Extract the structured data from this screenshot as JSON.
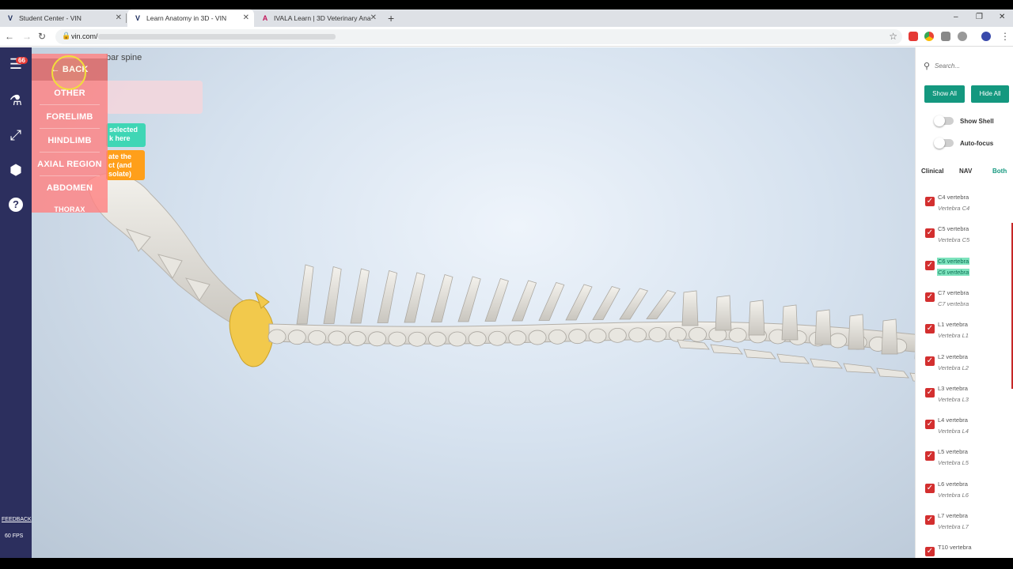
{
  "browser": {
    "tabs": [
      {
        "title": "Student Center - VIN",
        "favicon": "V",
        "active": false
      },
      {
        "title": "Learn Anatomy in 3D - VIN",
        "favicon": "V",
        "active": true
      },
      {
        "title": "IVALA Learn | 3D Veterinary Ana",
        "favicon": "A",
        "active": false
      }
    ],
    "new_tab": "+",
    "url": "vin.com/",
    "window_controls": {
      "minimize": "–",
      "maximize": "❐",
      "close": "✕"
    }
  },
  "leftbar": {
    "badge": "66",
    "feedback": "FEEDBACK",
    "fps": "60 FPS"
  },
  "viewport": {
    "breadcrumb": "bar spine",
    "hint_teal": "selected\nk here",
    "hint_orange": "ate the\nct (and\nsolate)",
    "menu": {
      "back": "← BACK",
      "items": [
        "OTHER",
        "FORELIMB",
        "HINDLIMB",
        "AXIAL REGION",
        "ABDOMEN",
        "THORAX"
      ]
    },
    "highlight_color": "#f2c94c",
    "bone_color": "#e8e6e0"
  },
  "rightpanel": {
    "search_placeholder": "Search...",
    "show_all": "Show All",
    "hide_all": "Hide All",
    "show_shell": "Show Shell",
    "auto_focus": "Auto-focus",
    "views": {
      "clinical": "Clinical",
      "nav": "NAV",
      "both": "Both"
    },
    "accent": "#14987f",
    "items": [
      {
        "name": "C4 vertebra",
        "latin": "Vertebra C4",
        "checked": true,
        "selected": false
      },
      {
        "name": "C5 vertebra",
        "latin": "Vertebra C5",
        "checked": true,
        "selected": false
      },
      {
        "name": "C6 vertebra",
        "latin": "C6 vertebra",
        "checked": true,
        "selected": true
      },
      {
        "name": "C7 vertebra",
        "latin": "C7 vertebra",
        "checked": true,
        "selected": false
      },
      {
        "name": "L1 vertebra",
        "latin": "Vertebra L1",
        "checked": true,
        "selected": false
      },
      {
        "name": "L2 vertebra",
        "latin": "Vertebra L2",
        "checked": true,
        "selected": false
      },
      {
        "name": "L3 vertebra",
        "latin": "Vertebra L3",
        "checked": true,
        "selected": false
      },
      {
        "name": "L4 vertebra",
        "latin": "Vertebra L4",
        "checked": true,
        "selected": false
      },
      {
        "name": "L5 vertebra",
        "latin": "Vertebra L5",
        "checked": true,
        "selected": false
      },
      {
        "name": "L6 vertebra",
        "latin": "Vertebra L6",
        "checked": true,
        "selected": false
      },
      {
        "name": "L7 vertebra",
        "latin": "Vertebra L7",
        "checked": true,
        "selected": false
      },
      {
        "name": "T10 vertebra",
        "latin": "",
        "checked": true,
        "selected": false
      }
    ]
  }
}
